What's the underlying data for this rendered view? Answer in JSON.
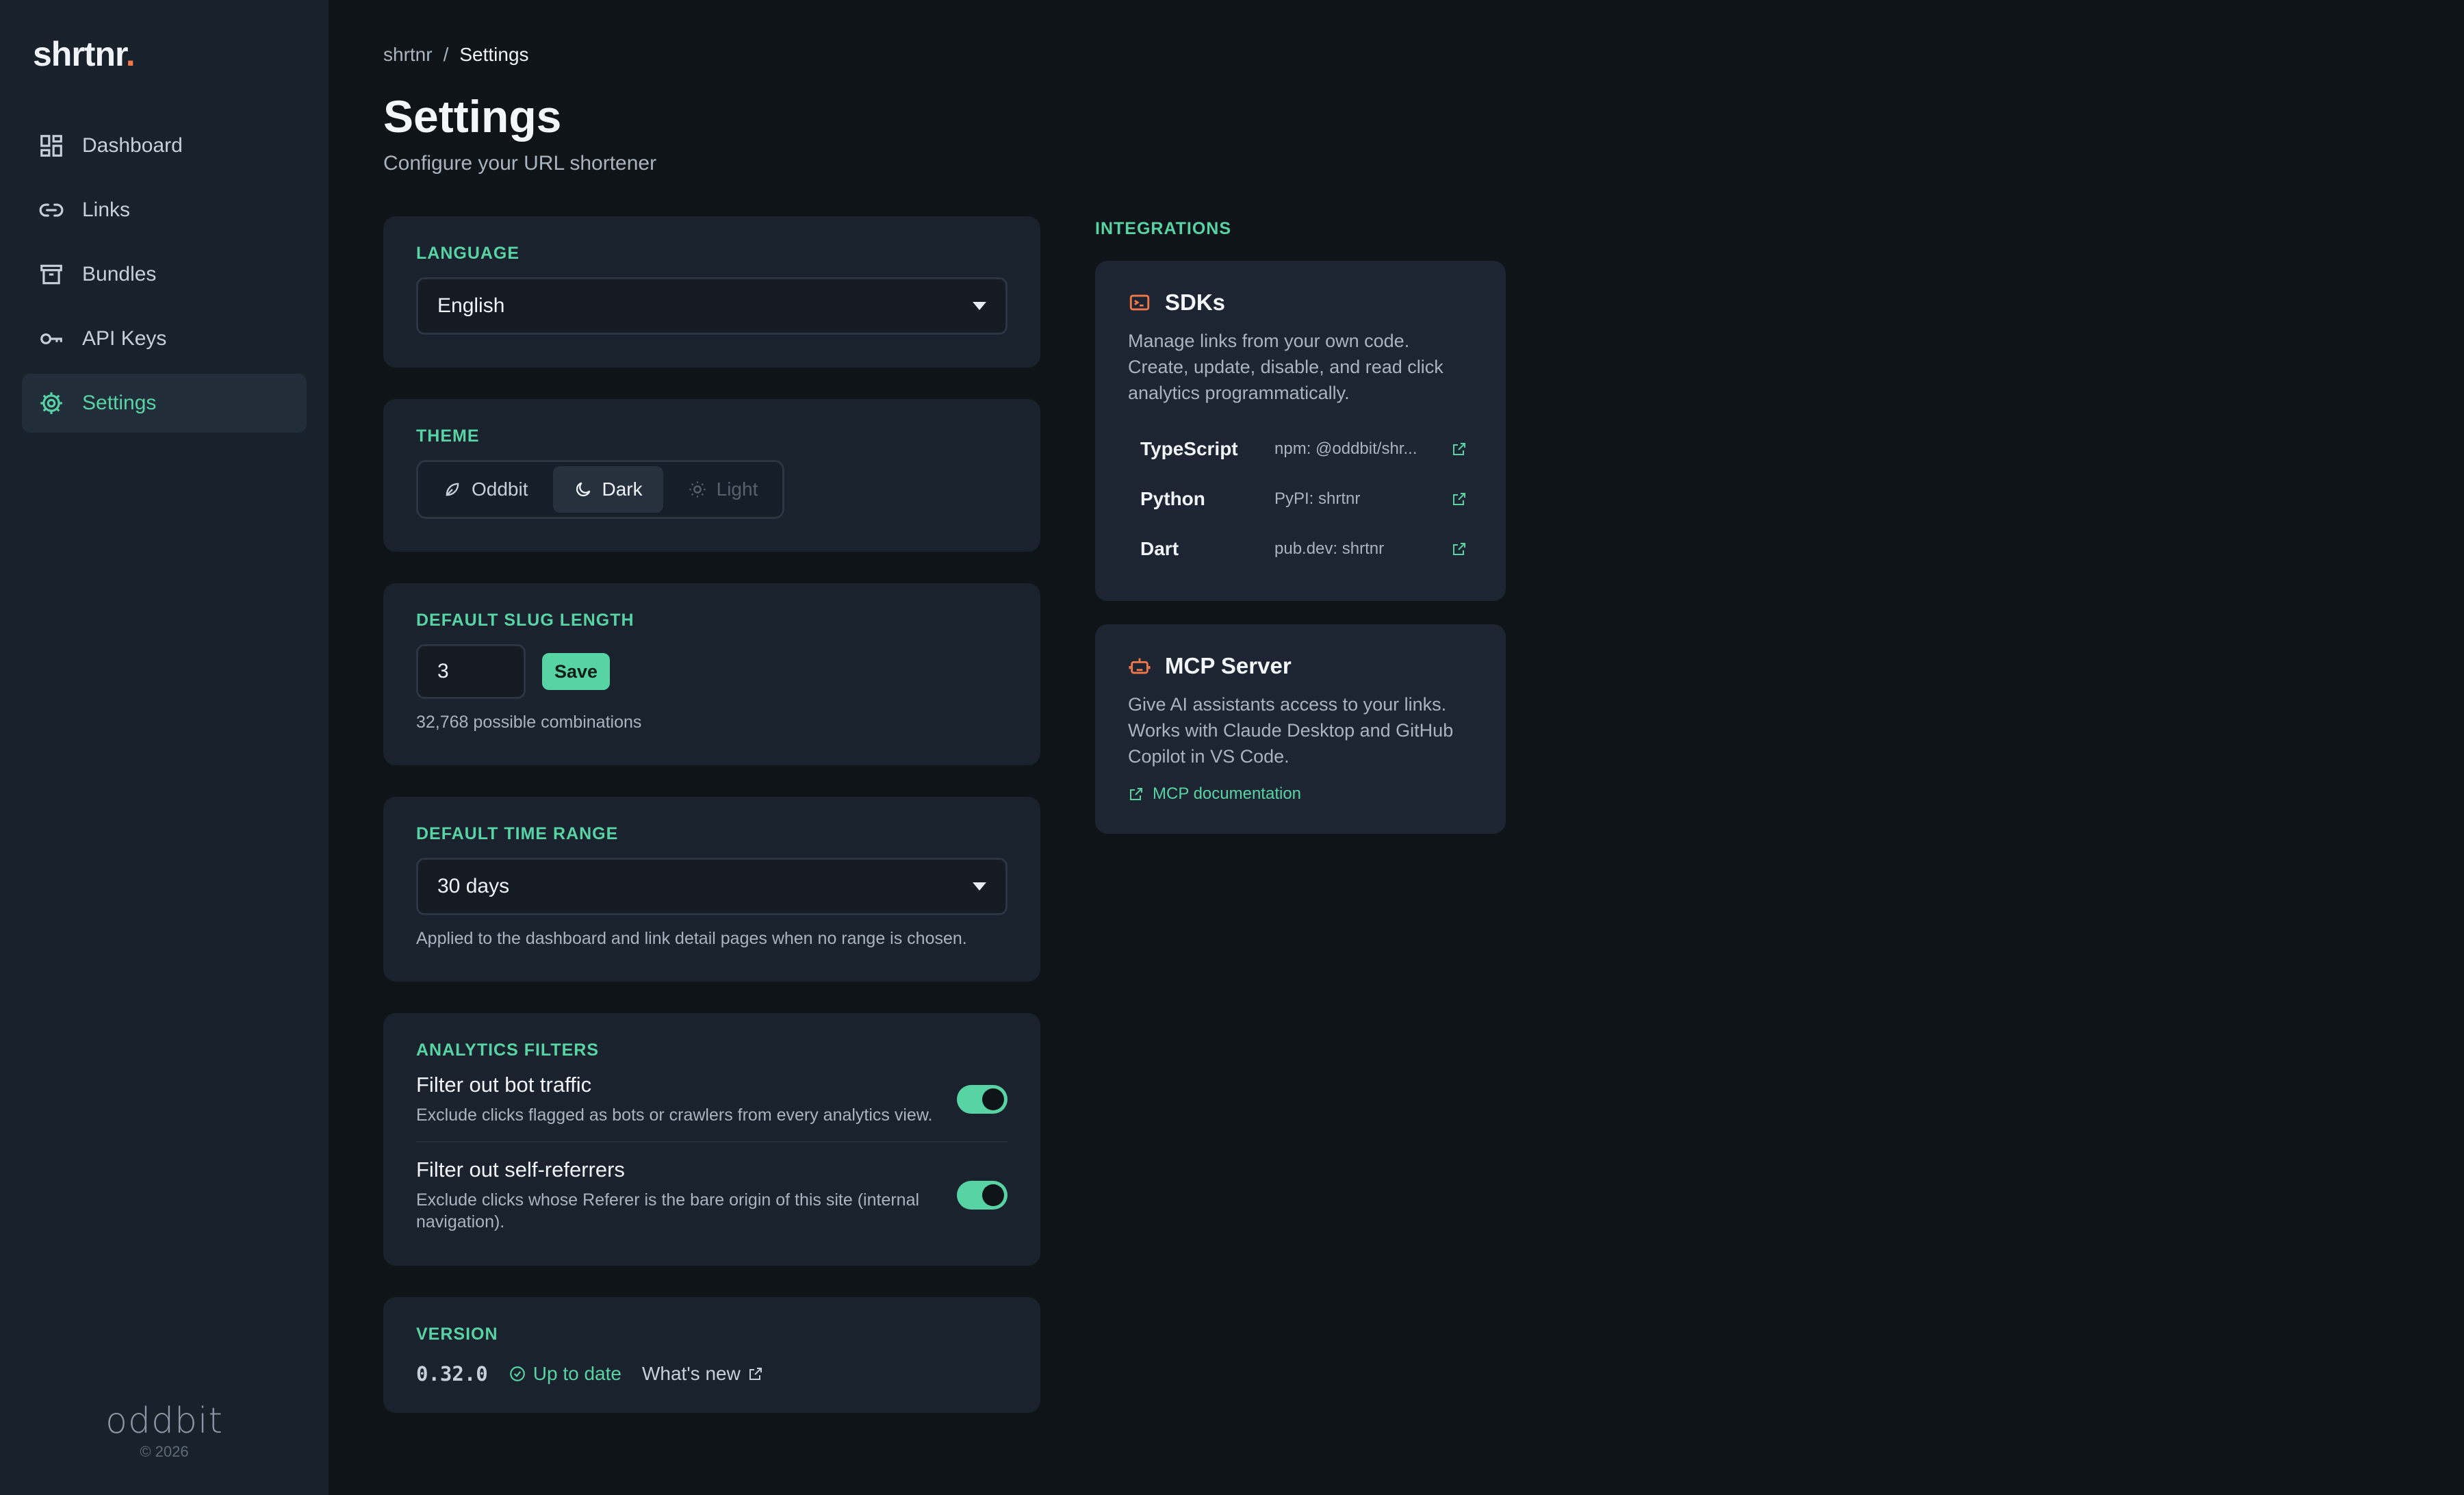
{
  "sidebar": {
    "logo_text": "shrtnr",
    "logo_dot": ".",
    "items": [
      {
        "label": "Dashboard",
        "icon": "dashboard-icon"
      },
      {
        "label": "Links",
        "icon": "link-icon"
      },
      {
        "label": "Bundles",
        "icon": "archive-icon"
      },
      {
        "label": "API Keys",
        "icon": "key-icon"
      },
      {
        "label": "Settings",
        "icon": "gear-icon",
        "active": true
      }
    ],
    "brand": "oddbit",
    "copyright": "© 2026"
  },
  "breadcrumb": {
    "root": "shrtnr",
    "separator": "/",
    "current": "Settings"
  },
  "header": {
    "title": "Settings",
    "subtitle": "Configure your URL shortener"
  },
  "language": {
    "label": "LANGUAGE",
    "value": "English"
  },
  "theme": {
    "label": "THEME",
    "options": [
      {
        "label": "Oddbit",
        "state": "normal"
      },
      {
        "label": "Dark",
        "state": "active"
      },
      {
        "label": "Light",
        "state": "disabled"
      }
    ]
  },
  "slug": {
    "label": "DEFAULT SLUG LENGTH",
    "value": "3",
    "save_label": "Save",
    "hint": "32,768 possible combinations"
  },
  "time_range": {
    "label": "DEFAULT TIME RANGE",
    "value": "30 days",
    "hint": "Applied to the dashboard and link detail pages when no range is chosen."
  },
  "analytics": {
    "label": "ANALYTICS FILTERS",
    "filters": [
      {
        "title": "Filter out bot traffic",
        "desc": "Exclude clicks flagged as bots or crawlers from every analytics view.",
        "enabled": true
      },
      {
        "title": "Filter out self-referrers",
        "desc": "Exclude clicks whose Referer is the bare origin of this site (internal navigation).",
        "enabled": true
      }
    ]
  },
  "version": {
    "label": "VERSION",
    "number": "0.32.0",
    "status": "Up to date",
    "whats_new": "What's new"
  },
  "integrations": {
    "label": "INTEGRATIONS",
    "sdks": {
      "title": "SDKs",
      "desc": "Manage links from your own code. Create, update, disable, and read click analytics programmatically.",
      "rows": [
        {
          "lang": "TypeScript",
          "pkg": "npm: @oddbit/shr..."
        },
        {
          "lang": "Python",
          "pkg": "PyPI: shrtnr"
        },
        {
          "lang": "Dart",
          "pkg": "pub.dev: shrtnr"
        }
      ]
    },
    "mcp": {
      "title": "MCP Server",
      "desc": "Give AI assistants access to your links. Works with Claude Desktop and GitHub Copilot in VS Code.",
      "link": "MCP documentation"
    }
  },
  "colors": {
    "accent": "#58d3a4",
    "logo_dot": "#f2784b",
    "icon_orange": "#f2784b"
  }
}
